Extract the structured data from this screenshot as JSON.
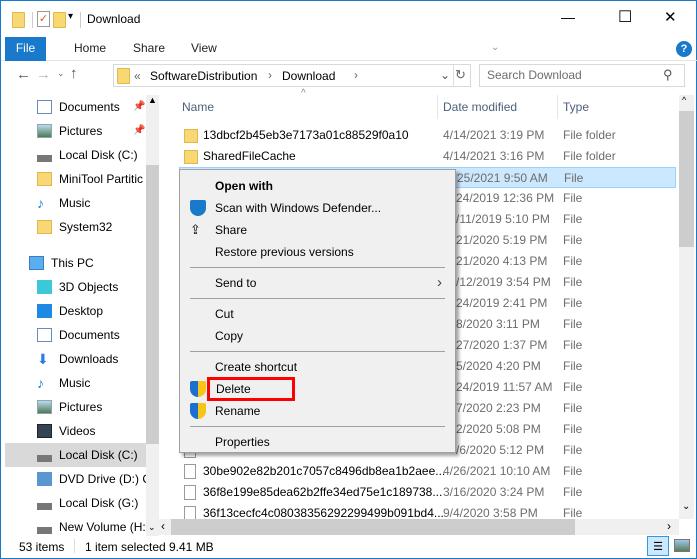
{
  "window": {
    "title": "Download",
    "controls": {
      "minimize": "—",
      "maximize": "☐",
      "close": "✕"
    }
  },
  "ribbon": {
    "tabs": [
      "File",
      "Home",
      "Share",
      "View"
    ],
    "help": "?"
  },
  "address": {
    "path": [
      "SoftwareDistribution",
      "Download"
    ],
    "overflow": "«"
  },
  "search": {
    "placeholder": "Search Download"
  },
  "columns": {
    "name": "Name",
    "date": "Date modified",
    "type": "Type"
  },
  "nav": {
    "items": [
      {
        "label": "Documents",
        "icon": "documents-icon",
        "pinned": true
      },
      {
        "label": "Pictures",
        "icon": "pictures-icon",
        "pinned": true
      },
      {
        "label": "Local Disk (C:)",
        "icon": "drive-icon"
      },
      {
        "label": "MiniTool Partitic",
        "icon": "folder-icon"
      },
      {
        "label": "Music",
        "icon": "music-icon"
      },
      {
        "label": "System32",
        "icon": "folder-icon"
      },
      {
        "label": "This PC",
        "icon": "computer-icon"
      },
      {
        "label": "3D Objects",
        "icon": "3d-objects-icon"
      },
      {
        "label": "Desktop",
        "icon": "desktop-icon"
      },
      {
        "label": "Documents",
        "icon": "documents-icon"
      },
      {
        "label": "Downloads",
        "icon": "downloads-icon"
      },
      {
        "label": "Music",
        "icon": "music-icon"
      },
      {
        "label": "Pictures",
        "icon": "pictures-icon"
      },
      {
        "label": "Videos",
        "icon": "videos-icon"
      },
      {
        "label": "Local Disk (C:)",
        "icon": "drive-icon",
        "selected": true
      },
      {
        "label": "DVD Drive (D:) C",
        "icon": "dvd-icon"
      },
      {
        "label": "Local Disk (G:)",
        "icon": "drive-icon"
      },
      {
        "label": "New Volume (H:",
        "icon": "drive-icon"
      }
    ]
  },
  "files": [
    {
      "name": "13dbcf2b45eb3e7173a01c88529f0a10",
      "date": "4/14/2021 3:19 PM",
      "type": "File folder",
      "kind": "folder"
    },
    {
      "name": "SharedFileCache",
      "date": "4/14/2021 3:16 PM",
      "type": "File folder",
      "kind": "folder"
    },
    {
      "name": "",
      "date": "25/2021 9:50 AM",
      "type": "File",
      "kind": "file",
      "selected": true
    },
    {
      "name": "",
      "date": "24/2019 12:36 PM",
      "type": "File",
      "kind": "file"
    },
    {
      "name": "",
      "date": "/11/2019 5:10 PM",
      "type": "File",
      "kind": "file"
    },
    {
      "name": "",
      "date": "21/2020 5:19 PM",
      "type": "File",
      "kind": "file"
    },
    {
      "name": "",
      "date": "21/2020 4:13 PM",
      "type": "File",
      "kind": "file"
    },
    {
      "name": "",
      "date": "/12/2019 3:54 PM",
      "type": "File",
      "kind": "file"
    },
    {
      "name": "",
      "date": "24/2019 2:41 PM",
      "type": "File",
      "kind": "file"
    },
    {
      "name": "",
      "date": "8/2020 3:11 PM",
      "type": "File",
      "kind": "file"
    },
    {
      "name": "",
      "date": "27/2020 1:37 PM",
      "type": "File",
      "kind": "file"
    },
    {
      "name": "",
      "date": "5/2020 4:20 PM",
      "type": "File",
      "kind": "file"
    },
    {
      "name": "",
      "date": "24/2019 11:57 AM",
      "type": "File",
      "kind": "file"
    },
    {
      "name": "",
      "date": "7/2020 2:23 PM",
      "type": "File",
      "kind": "file"
    },
    {
      "name": "",
      "date": "2/2020 5:08 PM",
      "type": "File",
      "kind": "file"
    },
    {
      "name": "",
      "date": "/6/2020 5:12 PM",
      "type": "File",
      "kind": "file"
    },
    {
      "name": "30be902e82b201c7057c8496db8ea1b2aee...",
      "date": "4/26/2021 10:10 AM",
      "type": "File",
      "kind": "file"
    },
    {
      "name": "36f8e199e85dea62b2ffe34ed75e1c189738...",
      "date": "3/16/2020 3:24 PM",
      "type": "File",
      "kind": "file"
    },
    {
      "name": "36f13cecfc4c08038356292299499b091bd4...",
      "date": "9/4/2020 3:58 PM",
      "type": "File",
      "kind": "file"
    }
  ],
  "context_menu": {
    "items": [
      {
        "label": "Open with",
        "bold": true
      },
      {
        "label": "Scan with Windows Defender...",
        "icon": "defender-icon"
      },
      {
        "label": "Share",
        "icon": "share-icon"
      },
      {
        "label": "Restore previous versions"
      },
      {
        "sep": true
      },
      {
        "label": "Send to",
        "submenu": true
      },
      {
        "sep": true
      },
      {
        "label": "Cut"
      },
      {
        "label": "Copy"
      },
      {
        "sep": true
      },
      {
        "label": "Create shortcut"
      },
      {
        "label": "Delete",
        "icon": "uac-shield-icon",
        "highlighted": true
      },
      {
        "label": "Rename",
        "icon": "uac-shield-icon"
      },
      {
        "sep": true
      },
      {
        "label": "Properties"
      }
    ],
    "highlight_color": "#ff0000"
  },
  "status": {
    "count": "53 items",
    "selected": "1 item selected",
    "size": "9.41 MB"
  },
  "colors": {
    "accent": "#1979ca",
    "selection": "#cce8ff"
  }
}
